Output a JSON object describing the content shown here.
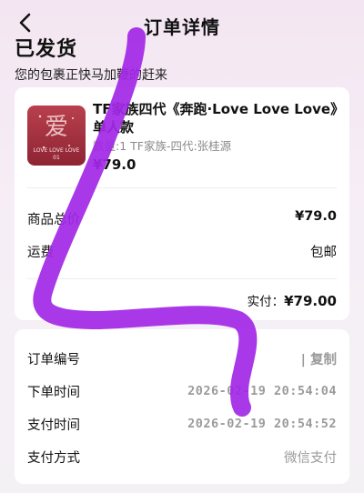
{
  "nav": {
    "title": "订单详情"
  },
  "status": {
    "title": "已发货",
    "subtitle": "您的包裹正快马加鞭的赶来"
  },
  "product": {
    "title": "TF家族四代《奔跑·Love Love Love》单人款",
    "spec": "数量:1 TF家族-四代:张桂源",
    "price": "¥79.0",
    "thumb_caption": "LOVE LOVE LOVE",
    "thumb_sub": "01"
  },
  "summary": {
    "goods_total_label": "商品总价",
    "goods_total_value": "¥79.0",
    "shipping_label": "运费",
    "shipping_value": "包邮",
    "paid_label": "实付：",
    "paid_value": "¥79.00"
  },
  "order_info": {
    "order_no_label": "订单编号",
    "copy_label": "| 复制",
    "order_time_label": "下单时间",
    "order_time_value": "2026-02-19 20:54:04",
    "pay_time_label": "支付时间",
    "pay_time_value": "2026-02-19 20:54:52",
    "pay_method_label": "支付方式",
    "pay_method_value": "微信支付"
  },
  "colors": {
    "scribble": "#a227e6",
    "thumb_bg": "#a8323f"
  }
}
